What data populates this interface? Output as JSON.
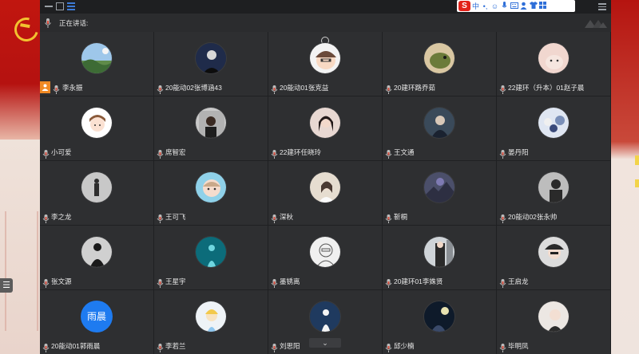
{
  "speaking_label": "正在讲话:",
  "ime": {
    "logo": "S",
    "lang": "中",
    "icons": [
      "dot-icon",
      "moon-icon",
      "emoji-icon",
      "mic-icon",
      "keyboard-icon",
      "person-icon",
      "shirt-icon",
      "grid-icon"
    ]
  },
  "colors": {
    "window_bg": "#2b2c2e",
    "tile_bg": "#2e2f31",
    "host_badge": "#f08a24",
    "text_avatar": "#1e7bf0"
  },
  "participants": [
    {
      "name": "李永振",
      "host": true,
      "avatar": "landscape"
    },
    {
      "name": "20能动02张博涵43",
      "host": false,
      "avatar": "dark-person"
    },
    {
      "name": "20能动01张克益",
      "host": false,
      "avatar": "cartoon-boy"
    },
    {
      "name": "20建环路乔茹",
      "host": false,
      "avatar": "bird"
    },
    {
      "name": "22建环（升本）01赵子晨",
      "host": false,
      "avatar": "pink-soft"
    },
    {
      "name": "小可爱",
      "host": false,
      "avatar": "cartoon-girl"
    },
    {
      "name": "席智宏",
      "host": false,
      "avatar": "selfie"
    },
    {
      "name": "22建环任晓玲",
      "host": false,
      "avatar": "girl-portrait"
    },
    {
      "name": "王文通",
      "host": false,
      "avatar": "anime-dark"
    },
    {
      "name": "晏丹阳",
      "host": false,
      "avatar": "anime-group"
    },
    {
      "name": "李之龙",
      "host": false,
      "avatar": "gray-figure"
    },
    {
      "name": "王可飞",
      "host": false,
      "avatar": "baby"
    },
    {
      "name": "深秋",
      "host": false,
      "avatar": "light-girl"
    },
    {
      "name": "靳桐",
      "host": false,
      "avatar": "purple-sky"
    },
    {
      "name": "20能动02张永帅",
      "host": false,
      "avatar": "gray-portrait"
    },
    {
      "name": "张文源",
      "host": false,
      "avatar": "dark-figure"
    },
    {
      "name": "王星宇",
      "host": false,
      "avatar": "teal-figure"
    },
    {
      "name": "墨锈离",
      "host": false,
      "avatar": "sketch"
    },
    {
      "name": "20建环01李姝贤",
      "host": false,
      "avatar": "street"
    },
    {
      "name": "王启龙",
      "host": false,
      "avatar": "hat-person"
    },
    {
      "name": "20能动01郭雨晨",
      "host": false,
      "avatar": "text",
      "avatar_text": "雨晨"
    },
    {
      "name": "李若兰",
      "host": false,
      "avatar": "fairy"
    },
    {
      "name": "刘思阳",
      "host": false,
      "avatar": "white-figure"
    },
    {
      "name": "邱少楠",
      "host": false,
      "avatar": "night-moon"
    },
    {
      "name": "毕明凤",
      "host": false,
      "avatar": "light-portrait"
    }
  ]
}
